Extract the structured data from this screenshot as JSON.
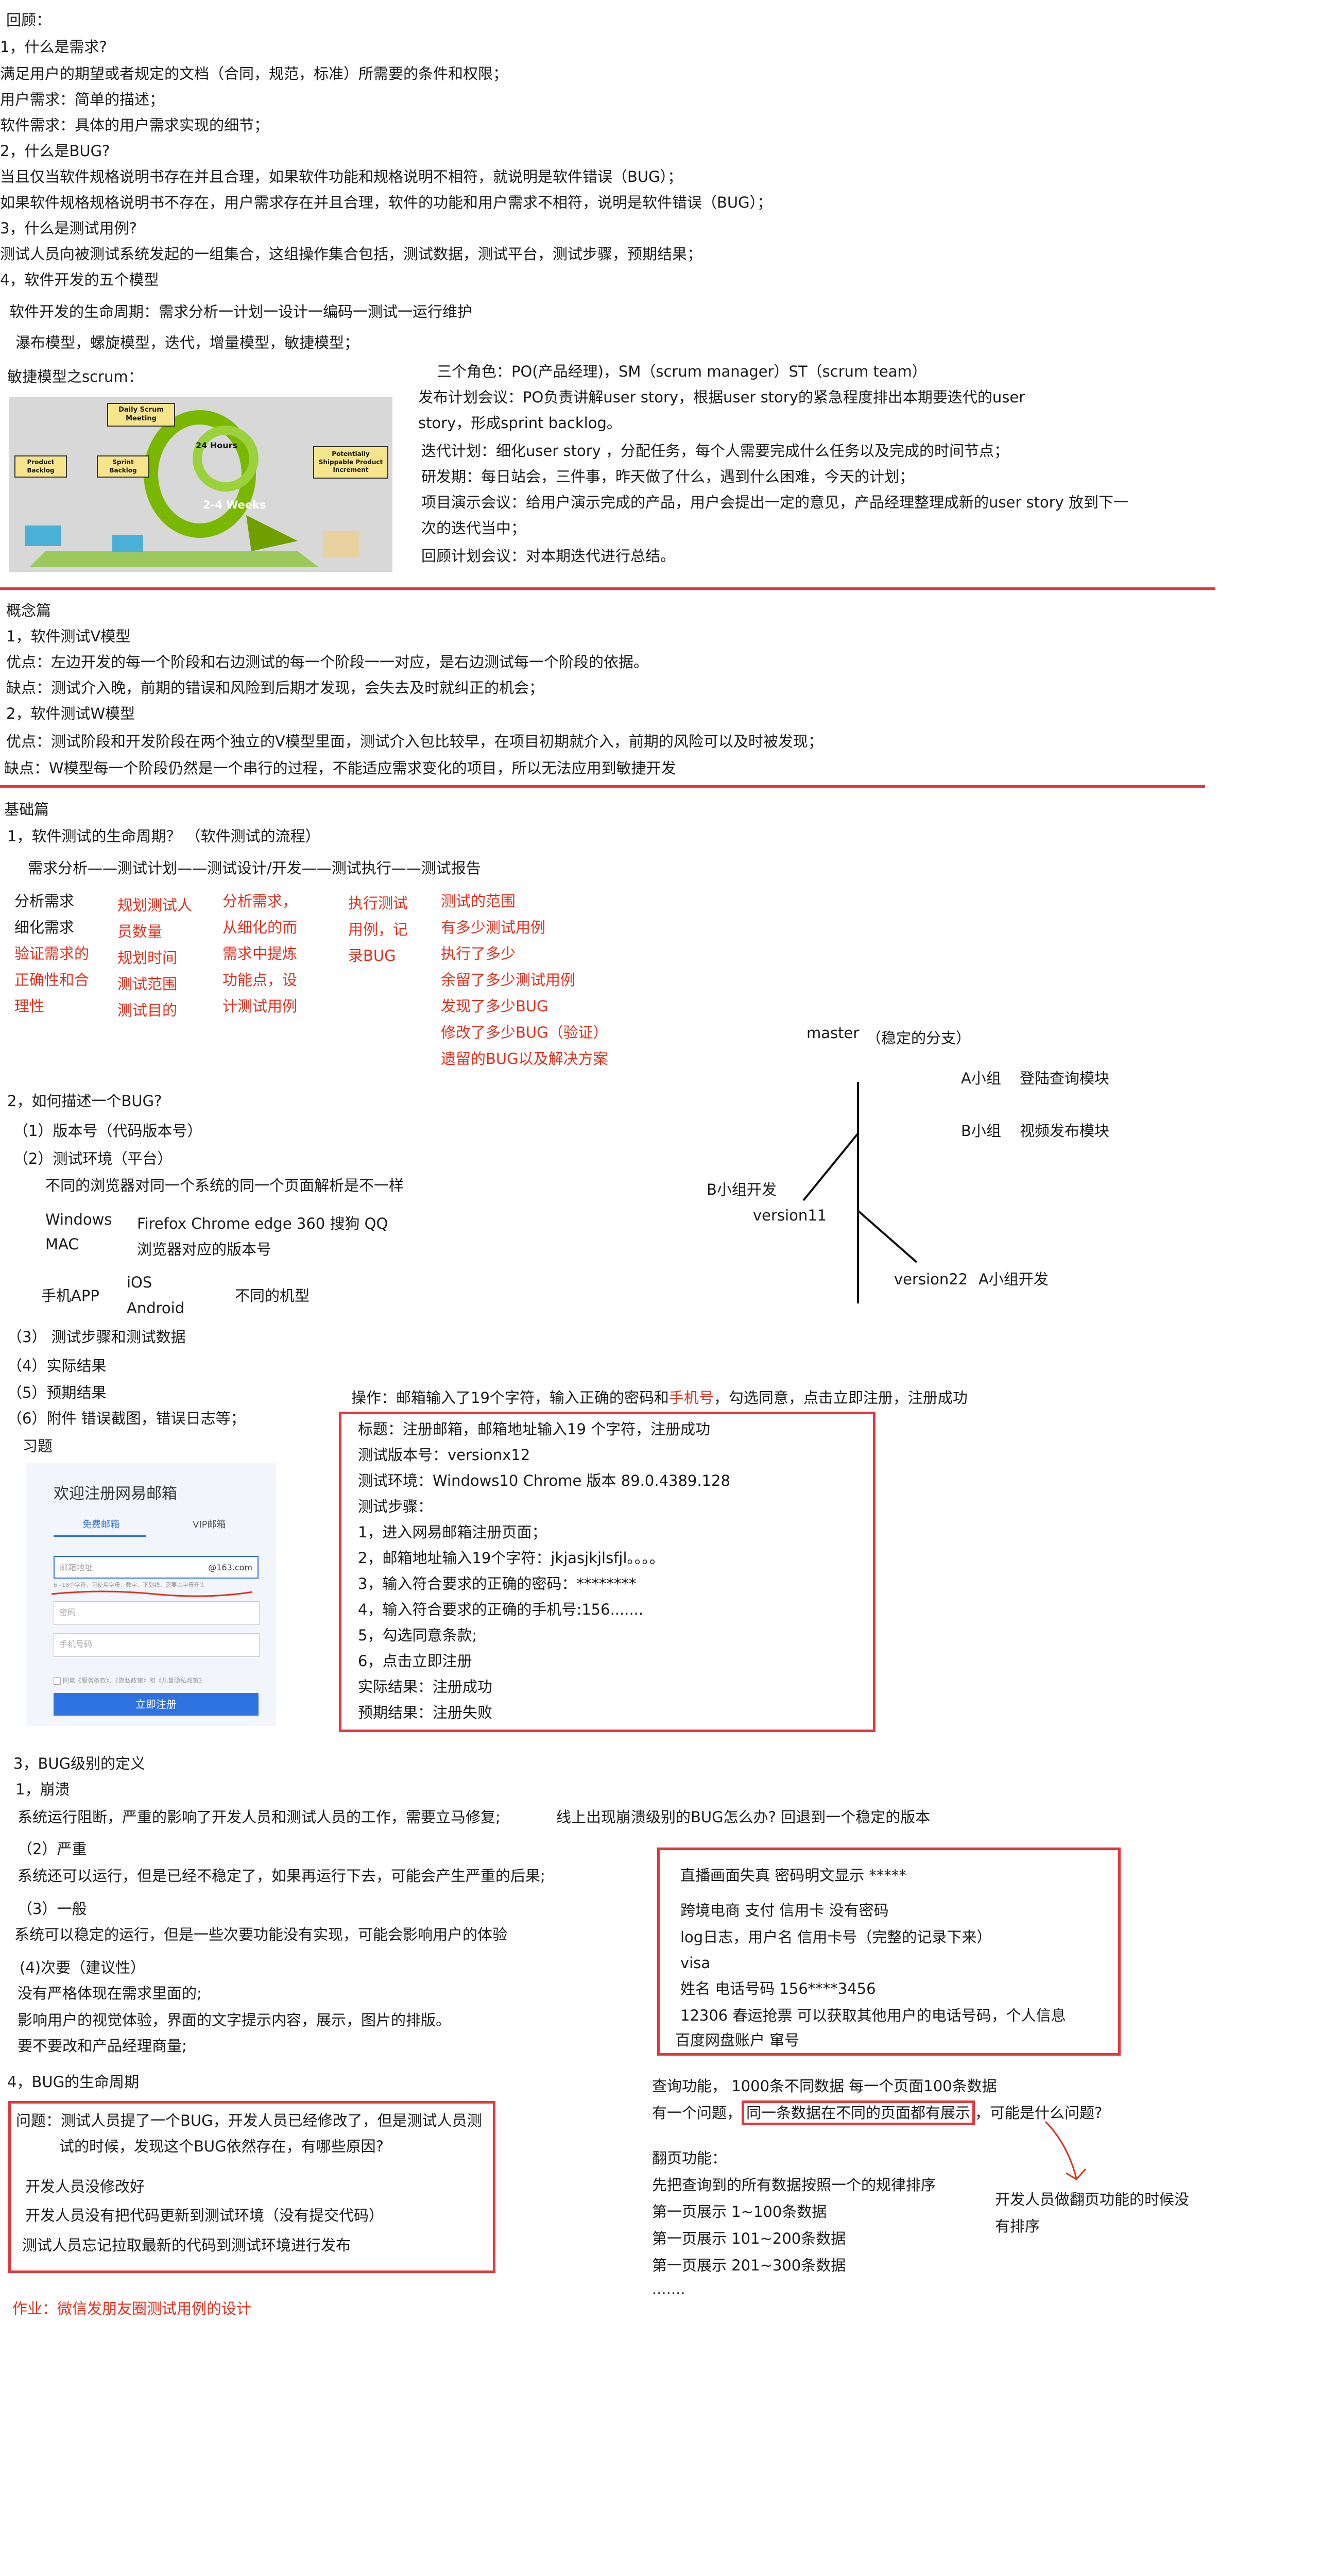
{
  "review": {
    "title": "回顾：",
    "q1": "1，什么是需求?",
    "q1_a": "满足用户的期望或者规定的文档（合同，规范，标准）所需要的条件和权限；",
    "q1_b": "用户需求：简单的描述；",
    "q1_c": "软件需求：具体的用户需求实现的细节；",
    "q2": "2，什么是BUG?",
    "q2_a": "当且仅当软件规格说明书存在并且合理，如果软件功能和规格说明不相符，就说明是软件错误（BUG）；",
    "q2_b": "如果软件规格规格说明书不存在，用户需求存在并且合理，软件的功能和用户需求不相符，说明是软件错误（BUG）；",
    "q3": "3，什么是测试用例?",
    "q3_a": "测试人员向被测试系统发起的一组集合，这组操作集合包括，测试数据，测试平台，测试步骤，预期结果；",
    "q4": "4，软件开发的五个模型",
    "q4_a": "软件开发的生命周期：需求分析一计划一设计一编码一测试一运行维护",
    "q4_b": "瀑布模型，螺旋模型，迭代，增量模型，敏捷模型；",
    "scrum_title": "敏捷模型之scrum：",
    "scrum_img": {
      "daily": "Daily Scrum Meeting",
      "hours": "24 Hours",
      "weeks": "2-4 Weeks",
      "product_backlog": "Product Backlog",
      "sprint_backlog": "Sprint Backlog",
      "increment": "Potentially Shippable Product Increment"
    },
    "roles": "三个角色：PO(产品经理)，SM（scrum manager）ST（scrum team）",
    "plan_meeting_1": "发布计划会议：PO负责讲解user story，根据user story的紧急程度排出本期要迭代的user",
    "plan_meeting_2": "story，形成sprint  backlog。",
    "iter_plan": "迭代计划：细化user story ，分配任务，每个人需要完成什么任务以及完成的时间节点；",
    "dev_meeting": "研发期：每日站会，三件事，昨天做了什么，遇到什么困难，今天的计划；",
    "demo_meeting_1": "项目演示会议：给用户演示完成的产品，用户会提出一定的意见，产品经理整理成新的user  story  放到下一",
    "demo_meeting_2": "次的迭代当中；",
    "retro": "回顾计划会议：对本期迭代进行总结。"
  },
  "concepts": {
    "title": "概念篇",
    "v_title": "1，软件测试V模型",
    "v_pro": "优点：左边开发的每一个阶段和右边测试的每一个阶段一一对应，是右边测试每一个阶段的依据。",
    "v_con": "缺点：测试介入晚，前期的错误和风险到后期才发现，会失去及时就纠正的机会；",
    "w_title": "2，软件测试W模型",
    "w_pro": "优点：测试阶段和开发阶段在两个独立的V模型里面，测试介入包比较早，在项目初期就介入，前期的风险可以及时被发现；",
    "w_con": "缺点：W模型每一个阶段仍然是一个串行的过程，不能适应需求变化的项目，所以无法应用到敏捷开发"
  },
  "basics": {
    "title": "基础篇",
    "lifecycle_title": "1，软件测试的生命周期？ （软件测试的流程）",
    "lifecycle_flow": "需求分析——测试计划——测试设计/开发——测试执行——测试报告",
    "col1": [
      "分析需求",
      "细化需求",
      "验证需求的",
      "正确性和合",
      "理性"
    ],
    "col2": [
      "规划测试人",
      "员数量",
      "规划时间",
      "测试范围",
      "测试目的"
    ],
    "col3": [
      "分析需求，",
      "从细化的而",
      "需求中提炼",
      "功能点，设",
      "计测试用例"
    ],
    "col4": [
      "执行测试",
      "用例，记",
      "录BUG"
    ],
    "col5": [
      "测试的范围",
      "有多少测试用例",
      "执行了多少",
      "余留了多少测试用例",
      "发现了多少BUG",
      "修改了多少BUG（验证）",
      "遗留的BUG以及解决方案"
    ],
    "branch": {
      "master": "master",
      "stable": "（稳定的分支）",
      "a_group": "A小组",
      "a_module": "登陆查询模块",
      "b_group": "B小组",
      "b_module": "视频发布模块",
      "b_dev": "B小组开发",
      "v11": "version11",
      "v22": "version22",
      "a_dev": "A小组开发"
    },
    "bug_desc_title": "2，如何描述一个BUG?",
    "version_no": "（1）版本号（代码版本号）",
    "env": "（2）测试环境（平台）",
    "env_note": "不同的浏览器对同一个系统的同一个页面解析是不一样",
    "windows": "Windows",
    "mac": "MAC",
    "browsers": "Firefox   Chrome   edge   360  搜狗   QQ",
    "browser_versions": "浏览器对应的版本号",
    "mobile_app": "手机APP",
    "ios": "iOS",
    "android": "Android",
    "models": "不同的机型",
    "steps": "（3）  测试步骤和测试数据",
    "actual": "（4）实际结果",
    "expected": "（5）预期结果",
    "attach": "（6）附件    错误截图，错误日志等；",
    "exercise": "习题",
    "operation_prefix": "操作：邮箱输入了19个字符，输入正确的密码和",
    "operation_phone": "手机号",
    "operation_suffix": "，勾选同意，点击立即注册，注册成功",
    "form": {
      "title": "欢迎注册网易邮箱",
      "tab_free": "免费邮箱",
      "tab_vip": "VIP邮箱",
      "email_placeholder": "邮箱地址",
      "domain": "@163.com",
      "hint": "6~18个字符，可使用字母、数字、下划线，需要以字母开头",
      "password": "密码",
      "phone": "手机号码",
      "agree": "同意《服务条款》、《隐私政策》和《儿童隐私政策》",
      "submit": "立即注册"
    },
    "bug_report": [
      "标题：注册邮箱，邮箱地址输入19 个字符，注册成功",
      "测试版本号：versionx12",
      "测试环境：Windows10     Chrome  版本 89.0.4389.128",
      "测试步骤：",
      "1，进入网易邮箱注册页面；",
      "2，邮箱地址输入19个字符：jkjasjkjlsfjl。。。。",
      "3，输入符合要求的正确的密码：********",
      "4，输入符合要求的正确的手机号:156.......",
      "5，勾选同意条款;",
      "6，点击立即注册",
      "实际结果：注册成功",
      "预期结果：注册失败"
    ],
    "level_title": "3，BUG级别的定义",
    "crash": "1，崩溃",
    "crash_desc": "系统运行阻断，严重的影响了开发人员和测试人员的工作，需要立马修复;",
    "crash_online": "线上出现崩溃级别的BUG怎么办?      回退到一个稳定的版本",
    "severe": "（2）严重",
    "severe_desc": "系统还可以运行，但是已经不稳定了，如果再运行下去，可能会产生严重的后果;",
    "normal": "（3）一般",
    "normal_desc": "系统可以稳定的运行，但是一些次要功能没有实现，可能会影响用户的体验",
    "minor": "(4)次要（建议性）",
    "minor_a": "没有严格体现在需求里面的;",
    "minor_b": "影响用户的视觉体验，界面的文字提示内容，展示，图片的排版。",
    "minor_c": "要不要改和产品经理商量;",
    "severe_examples": [
      "直播画面失真      密码明文显示  *****",
      "跨境电商    支付     信用卡   没有密码",
      "log日志，用户名  信用卡号（完整的记录下来）",
      "visa",
      "姓名   电话号码        156****3456",
      "12306  春运抢票   可以获取其他用户的电话号码，个人信息",
      "百度网盘账户   窜号"
    ],
    "bug_life": "4，BUG的生命周期",
    "question_1": "问题：测试人员提了一个BUG，开发人员已经修改了，但是测试人员测",
    "question_2": "试的时候，发现这个BUG依然存在，有哪些原因?",
    "reasons": [
      "开发人员没修改好",
      "开发人员没有把代码更新到测试环境（没有提交代码）",
      "测试人员忘记拉取最新的代码到测试环境进行发布"
    ],
    "query_1": "查询功能，     1000条不同数据       每一个页面100条数据",
    "query_2_prefix": "有一个问题，",
    "query_2_box": "同一条数据在不同的页面都有展示",
    "query_2_suffix": "，可能是什么问题?",
    "paging_title": "翻页功能：",
    "paging_rule": "先把查询到的所有数据按照一个的规律排序",
    "page1": "第一页展示    1~100条数据",
    "page2": "第一页展示    101~200条数据",
    "page3": "第一页展示    201~300条数据",
    "ellipsis": ".......",
    "paging_answer_1": "开发人员做翻页功能的时候没",
    "paging_answer_2": "有排序",
    "homework": "作业：微信发朋友圈测试用例的设计"
  }
}
